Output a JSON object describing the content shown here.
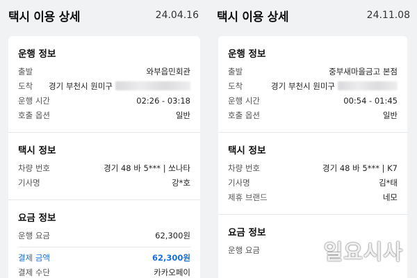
{
  "left": {
    "title": "택시 이용 상세",
    "date": "24.04.16",
    "trip_info": {
      "title": "운행 정보",
      "origin_label": "출발",
      "origin_value": "와부읍민회관",
      "dest_label": "도착",
      "dest_value": "경기 부천시 원미구",
      "time_label": "운행 시간",
      "time_value": "02:26 - 03:18",
      "call_label": "호출 옵션",
      "call_value": "일반"
    },
    "taxi_info": {
      "title": "택시 정보",
      "vehicle_label": "차량 번호",
      "vehicle_value": "경기 48 바 5*** | 쏘나타",
      "driver_label": "기사명",
      "driver_value": "강*호"
    },
    "fare_info": {
      "title": "요금 정보",
      "fare_label": "운행 요금",
      "fare_value": "62,300원",
      "paid_label": "결제 금액",
      "paid_value": "62,300원",
      "method_label": "결제 수단",
      "method_value": "카카오페이"
    }
  },
  "right": {
    "title": "택시 이용 상세",
    "date": "24.11.08",
    "trip_info": {
      "title": "운행 정보",
      "origin_label": "출발",
      "origin_value": "중부새마을금고 본점",
      "dest_label": "도착",
      "dest_value": "경기 부천시 원미구",
      "time_label": "운행 시간",
      "time_value": "00:54 - 01:45",
      "call_label": "호출 옵션",
      "call_value": "일반"
    },
    "taxi_info": {
      "title": "택시 정보",
      "vehicle_label": "차량 번호",
      "vehicle_value": "경기 48 바 5*** | K7",
      "driver_label": "기사명",
      "driver_value": "김*태",
      "partner_label": "제휴 브랜드",
      "partner_value": "네모"
    },
    "fare_info": {
      "title": "요금 정보",
      "fare_label": "운행 요금"
    }
  },
  "watermark": "일요시사",
  "colors": {
    "accent": "#1a6fd6",
    "background": "#f1f2f4",
    "card": "#ffffff"
  }
}
